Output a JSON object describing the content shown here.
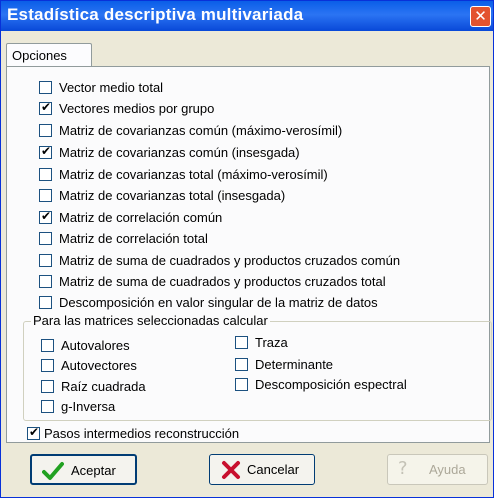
{
  "window": {
    "title": "Estadística descriptiva multivariada",
    "close_symbol": "✕"
  },
  "tab": {
    "label": "Opciones"
  },
  "options": [
    {
      "label": "Vector medio total",
      "checked": false
    },
    {
      "label": "Vectores medios por grupo",
      "checked": true
    },
    {
      "label": "Matriz de covarianzas común (máximo-verosímil)",
      "checked": false
    },
    {
      "label": "Matriz de covarianzas común  (insesgada)",
      "checked": true
    },
    {
      "label": "Matriz de covarianzas total (máximo-verosímil)",
      "checked": false
    },
    {
      "label": "Matriz de covarianzas total (insesgada)",
      "checked": false
    },
    {
      "label": "Matriz de correlación común",
      "checked": true
    },
    {
      "label": "Matriz de correlación total",
      "checked": false
    },
    {
      "label": "Matriz de suma de cuadrados y productos cruzados común",
      "checked": false
    },
    {
      "label": "Matriz de suma de cuadrados y productos cruzados total",
      "checked": false
    },
    {
      "label": "Descomposición en valor singular de la matriz de datos",
      "checked": false
    }
  ],
  "group": {
    "title": "Para las matrices seleccionadas calcular",
    "left": [
      {
        "label": "Autovalores",
        "checked": false
      },
      {
        "label": "Autovectores",
        "checked": false
      },
      {
        "label": "Raíz cuadrada",
        "checked": false
      },
      {
        "label": "g-Inversa",
        "checked": false
      }
    ],
    "right": [
      {
        "label": "Traza",
        "checked": false
      },
      {
        "label": "Determinante",
        "checked": false
      },
      {
        "label": "Descomposición espectral",
        "checked": false
      }
    ]
  },
  "intermediate": {
    "label": "Pasos intermedios reconstrucción",
    "checked": true
  },
  "buttons": {
    "accept": {
      "label": "Aceptar",
      "icon": "check-icon"
    },
    "cancel": {
      "label": "Cancelar",
      "icon": "x-icon"
    },
    "help": {
      "label": "Ayuda",
      "icon": "question-icon",
      "enabled": false
    }
  },
  "colors": {
    "titlebar": "#0a5ee8",
    "close": "#e3532f",
    "check_green": "#21a121",
    "cancel_red": "#c8102e"
  }
}
